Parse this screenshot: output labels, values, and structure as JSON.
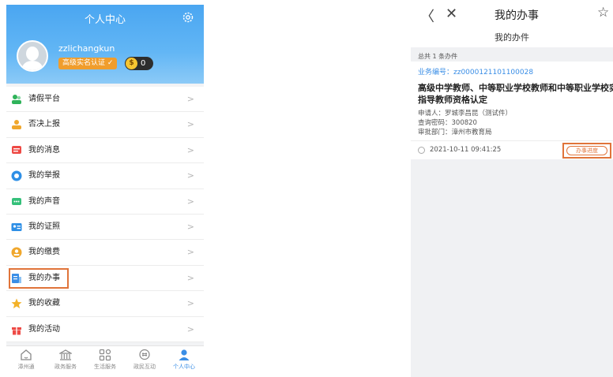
{
  "left": {
    "header": {
      "title": "个人中心",
      "username": "zzlichangkun",
      "badge": "高级实名认证",
      "coins": "0"
    },
    "menu": [
      {
        "label": "请假平台",
        "color": "#2fb35a"
      },
      {
        "label": "否决上报",
        "color": "#f0a72c"
      },
      {
        "label": "我的消息",
        "color": "#ee4a45"
      },
      {
        "label": "我的举报",
        "color": "#2e8fe6"
      },
      {
        "label": "我的声音",
        "color": "#35c07a"
      },
      {
        "label": "我的证照",
        "color": "#2e8fe6"
      },
      {
        "label": "我的缴费",
        "color": "#f0a72c"
      },
      {
        "label": "我的办事",
        "color": "#3a8ee6"
      },
      {
        "label": "我的收藏",
        "color": "#f3b229"
      },
      {
        "label": "我的活动",
        "color": "#ee4a45"
      }
    ],
    "arrow": ">",
    "tabs": [
      {
        "label": "漳州通",
        "icon": "home-icon"
      },
      {
        "label": "政务服务",
        "icon": "government-icon"
      },
      {
        "label": "生活服务",
        "icon": "grid-icon"
      },
      {
        "label": "政民互动",
        "icon": "chat-icon"
      },
      {
        "label": "个人中心",
        "icon": "person-icon"
      }
    ]
  },
  "right": {
    "header": {
      "back": "〈",
      "close": "✕",
      "title": "我的办事",
      "star": "☆",
      "subtitle": "我的办件"
    },
    "total": "总共 1 条办件",
    "record": {
      "number": "业务编号：zz0000121101100028",
      "title": "高级中学教师、中等职业学校教师和中等职业学校实习指导教师资格认定",
      "applicant": "申请人：罗城李昌昆（测试件）",
      "query_code": "查询密码：300820",
      "department": "审批部门：漳州市教育局",
      "time": "2021-10-11 09:41:25",
      "progress_button": "办事进度"
    }
  },
  "colors": {
    "header_blue": "#4aa6f1",
    "highlight": "#e0743a",
    "link_blue": "#3a8ee6"
  }
}
